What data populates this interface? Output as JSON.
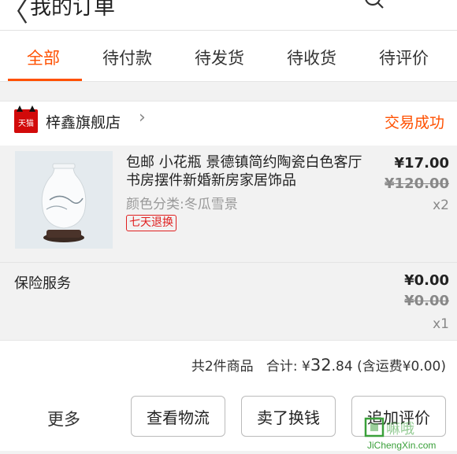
{
  "header": {
    "title": "我的订单",
    "back_icon": "chevron-left-icon",
    "search_icon": "search-icon",
    "more_label": "···"
  },
  "tabs": [
    {
      "label": "全部",
      "active": true
    },
    {
      "label": "待付款"
    },
    {
      "label": "待发货"
    },
    {
      "label": "待收货"
    },
    {
      "label": "待评价"
    }
  ],
  "store": {
    "badge_text": "天猫",
    "name": "梓鑫旗舰店",
    "status": "交易成功"
  },
  "item": {
    "title": "包邮 小花瓶 景德镇简约陶瓷白色客厅书房摆件新婚新房家居饰品",
    "sku": "颜色分类:冬瓜雪景",
    "badge": "七天退换",
    "price": "¥17.00",
    "original_price": "¥120.00",
    "quantity": "x2"
  },
  "insurance": {
    "label": "保险服务",
    "price": "¥0.00",
    "original_price": "¥0.00",
    "quantity": "x1"
  },
  "summary": {
    "count": "共2件商品",
    "total_label": "合计:",
    "currency": "¥",
    "total_int": "32",
    "total_dec": ".84",
    "shipping": "(含运费¥0.00)"
  },
  "actions": {
    "more": "更多",
    "logistics": "查看物流",
    "resell": "卖了换钱",
    "review": "追加评价"
  },
  "watermark": {
    "text": "JiChengXin.com"
  },
  "colors": {
    "accent": "#ff5000",
    "tmall": "#d20a0a"
  }
}
